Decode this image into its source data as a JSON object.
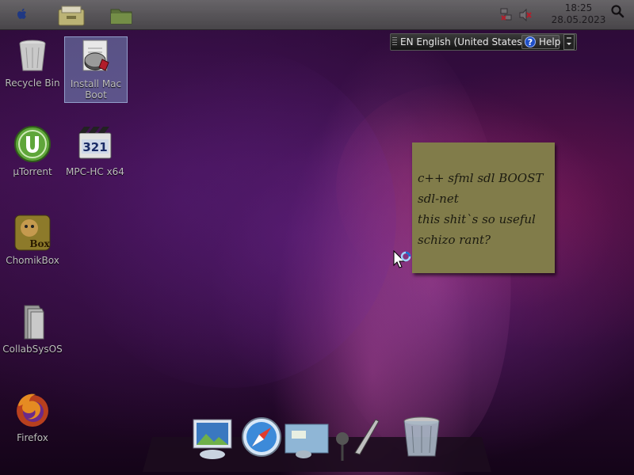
{
  "menubar": {
    "time": "18:25",
    "date": "28.05.2023",
    "icons": [
      "apple-icon",
      "file-cabinet-icon",
      "folder-icon",
      "network-disconnected-icon",
      "volume-muted-icon",
      "search-icon"
    ]
  },
  "langbar": {
    "language": "EN English (United States)",
    "help_label": "Help"
  },
  "desktop_icons": [
    {
      "label": "Recycle Bin",
      "icon": "recycle-bin-icon"
    },
    {
      "label_line1": "Install Mac",
      "label_line2": "Boot",
      "icon": "install-mac-boot-icon",
      "selected": true
    },
    {
      "label": "µTorrent",
      "icon": "utorrent-icon"
    },
    {
      "label": "MPC-HC x64",
      "icon": "mpc-hc-icon",
      "icon_text": "321"
    },
    {
      "label": "ChomikBox",
      "icon": "chomikbox-icon",
      "icon_text": "Box"
    },
    {
      "label": "CollabSysOS",
      "icon": "collabsysos-icon"
    },
    {
      "label": "Firefox",
      "icon": "firefox-icon"
    }
  ],
  "sticky_note": {
    "lines": [
      "c++ sfml sdl BOOST",
      "sdl-net",
      "this shit`s so useful",
      "schizo rant?"
    ]
  },
  "dock": {
    "items": [
      "preview-icon",
      "safari-compass-icon",
      "desktop-photo-icon",
      "paintbrush-icon",
      "trash-icon"
    ]
  },
  "colors": {
    "note_bg": "#817c4a",
    "menubar_bg": "#5a5a5a",
    "selection": "#7a8cbe"
  }
}
